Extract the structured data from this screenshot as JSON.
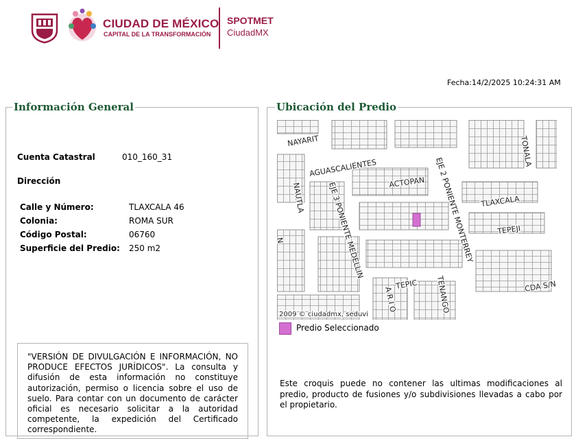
{
  "header": {
    "brand_title": "CIUDAD DE MÉXICO",
    "brand_subtitle": "CAPITAL DE LA TRANSFORMACIÓN",
    "app_title": "SPOTMET",
    "app_subtitle": "CiudadMX",
    "date": "Fecha:14/2/2025 10:24:31 AM"
  },
  "general": {
    "legend": "Información General",
    "cuenta_label": "Cuenta Catastral",
    "cuenta_value": "010_160_31",
    "direccion_label": "Dirección",
    "fields": [
      {
        "label": "Calle y Número:",
        "value": "TLAXCALA 46"
      },
      {
        "label": "Colonia:",
        "value": "ROMA SUR"
      },
      {
        "label": "Código Postal:",
        "value": "06760"
      },
      {
        "label": "Superficie del Predio:",
        "value": "250 m2"
      }
    ],
    "notice": "\"VERSIÓN DE DIVULGACIÓN E INFORMACIÓN, NO PRODUCE EFECTOS JURÍDICOS\". La consulta y difusión de esta información no constituye autorización, permiso o licencia sobre el uso de suelo. Para contar con un documento de carácter oficial es necesario solicitar a la autoridad competente, la expedición del Certificado correspondiente."
  },
  "ubicacion": {
    "legend": "Ubicación del Predio",
    "map": {
      "streets": [
        "NAYARIT",
        "AGUASCALIENTES",
        "ACTOPAN",
        "TLAXCALA",
        "TEPEJI",
        "TONALA",
        "NAUTLA",
        "EJE 3 PONIENTE MEDELLIN",
        "EJE 2 PONIENTE MONTERREY",
        "TEPIC",
        "TENANGO",
        "A R I O",
        "CDA S/N",
        "N"
      ],
      "copyright": "2009 © ciudadmx, seduvi",
      "selected_color": "#d46fd2"
    },
    "legend_item": "Predio Seleccionado",
    "disclaimer": "Este croquis puede no contener las ultimas modificaciones al predio, producto de fusiones y/o subdivisiones llevadas a cabo por el propietario."
  }
}
